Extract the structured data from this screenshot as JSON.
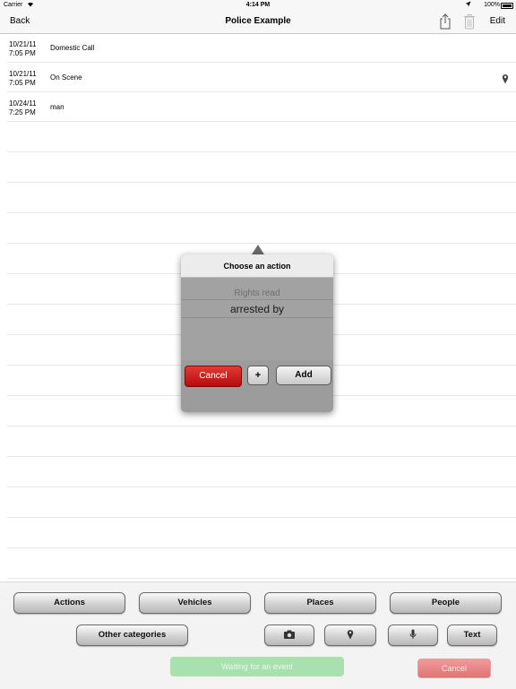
{
  "status_bar": {
    "carrier": "Carrier",
    "time": "4:14 PM",
    "battery": "100%"
  },
  "nav": {
    "back_label": "Back",
    "title": "Police Example",
    "edit_label": "Edit",
    "share_icon": "share-icon",
    "trash_icon": "trash-icon"
  },
  "events": [
    {
      "date": "10/21/11",
      "time": "7:05 PM",
      "desc": "Domestic Call",
      "has_location": false
    },
    {
      "date": "10/21/11",
      "time": "7:05 PM",
      "desc": "On Scene",
      "has_location": true
    },
    {
      "date": "10/24/11",
      "time": "7:25 PM",
      "desc": "man",
      "has_location": false
    }
  ],
  "popover": {
    "title": "Choose an action",
    "options": [
      "Rights read",
      "arrested by"
    ],
    "selected": "arrested by",
    "cancel_label": "Cancel",
    "plus_label": "+",
    "add_label": "Add"
  },
  "toolbar": {
    "categories": [
      "Actions",
      "Vehicles",
      "Places",
      "People"
    ],
    "other_label": "Other categories",
    "media_icons": [
      "camera-icon",
      "location-pin-icon",
      "microphone-icon"
    ],
    "text_label": "Text",
    "waiting_label": "Waiting for an event",
    "cancel_label": "Cancel"
  },
  "colors": {
    "accent_red": "#c4161a",
    "waiting_green": "#a9e0b0",
    "cancel_pink": "#e88585"
  }
}
